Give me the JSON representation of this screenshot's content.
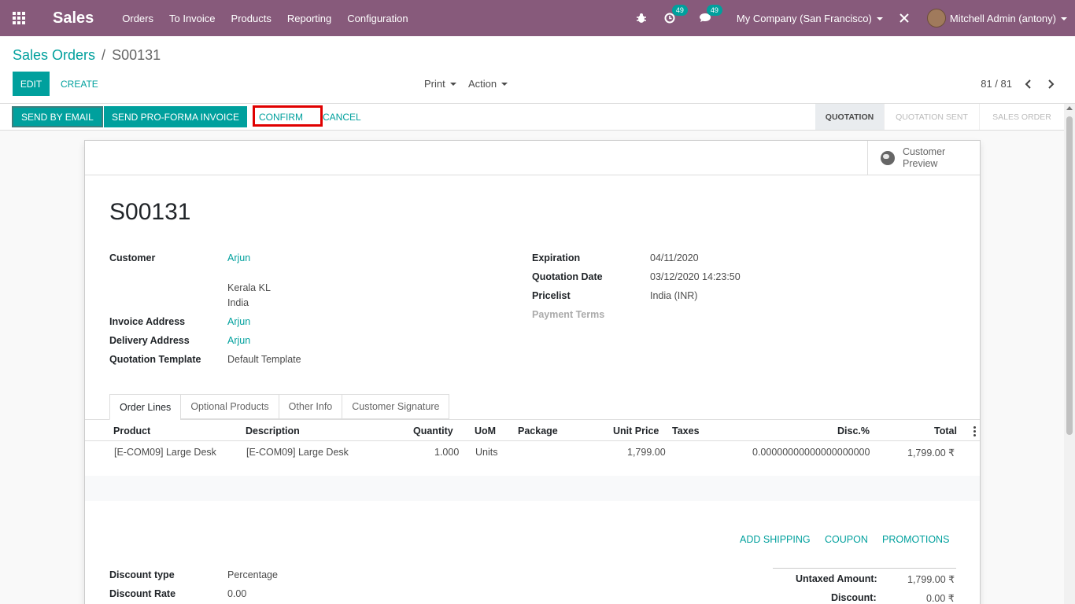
{
  "navbar": {
    "app_name": "Sales",
    "menu": [
      "Orders",
      "To Invoice",
      "Products",
      "Reporting",
      "Configuration"
    ],
    "activity_count": "49",
    "messages_count": "49",
    "company": "My Company (San Francisco)",
    "user": "Mitchell Admin (antony)",
    "bg_color": "#875a7b"
  },
  "breadcrumb": {
    "parent": "Sales Orders",
    "separator": "/",
    "current": "S00131"
  },
  "control": {
    "edit_label": "Edit",
    "create_label": "Create",
    "print_label": "Print",
    "action_label": "Action",
    "pager": "81 / 81"
  },
  "statusbar": {
    "send_email": "Send by Email",
    "send_proforma": "Send Pro-Forma Invoice",
    "confirm": "Confirm",
    "cancel": "Cancel",
    "stages": [
      "Quotation",
      "Quotation Sent",
      "Sales Order"
    ],
    "active_stage": "Quotation"
  },
  "sheet": {
    "preview_label": "Customer Preview",
    "title": "S00131",
    "left_fields": {
      "customer_label": "Customer",
      "customer_value": "Arjun",
      "address_line1": "Kerala KL",
      "address_line2": "India",
      "invoice_label": "Invoice Address",
      "invoice_value": "Arjun",
      "delivery_label": "Delivery Address",
      "delivery_value": "Arjun",
      "template_label": "Quotation Template",
      "template_value": "Default Template"
    },
    "right_fields": {
      "expiration_label": "Expiration",
      "expiration_value": "04/11/2020",
      "qdate_label": "Quotation Date",
      "qdate_value": "03/12/2020 14:23:50",
      "pricelist_label": "Pricelist",
      "pricelist_value": "India (INR)",
      "terms_label": "Payment Terms"
    },
    "tabs": [
      "Order Lines",
      "Optional Products",
      "Other Info",
      "Customer Signature"
    ],
    "columns": [
      "Product",
      "Description",
      "Quantity",
      "UoM",
      "Package",
      "Unit Price",
      "Taxes",
      "Disc.%",
      "Total"
    ],
    "lines": [
      {
        "product": "[E-COM09] Large Desk",
        "description": "[E-COM09] Large Desk",
        "quantity": "1.000",
        "uom": "Units",
        "package": "",
        "unit_price": "1,799.00",
        "taxes": "",
        "discount": "0.00000000000000000000",
        "total": "1,799.00 ₹"
      }
    ],
    "actions": [
      "Add Shipping",
      "Coupon",
      "Promotions"
    ],
    "bottom_fields": {
      "discount_type_label": "Discount type",
      "discount_type_value": "Percentage",
      "discount_rate_label": "Discount Rate",
      "discount_rate_value": "0.00"
    },
    "totals": {
      "untaxed_label": "Untaxed Amount:",
      "untaxed_value": "1,799.00 ₹",
      "discount_label": "Discount:",
      "discount_value": "0.00 ₹"
    }
  }
}
